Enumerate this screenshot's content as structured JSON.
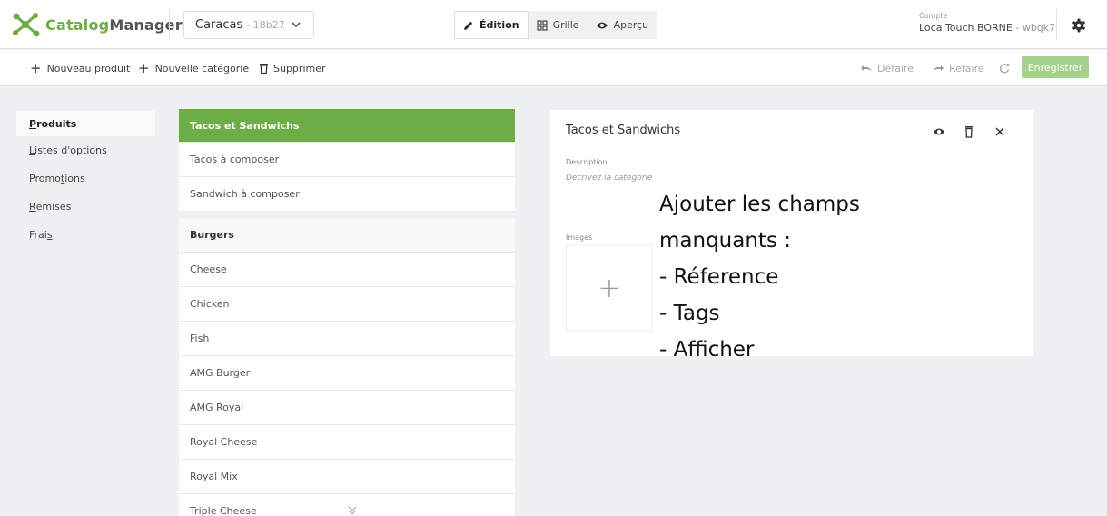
{
  "app": {
    "name_part1": "Catalog",
    "name_part2": "Manager",
    "brand_color": "#6cae45"
  },
  "site": {
    "name": "Caracas",
    "code": "- 18b27"
  },
  "modes": [
    {
      "label": "Édition",
      "icon": "pencil-icon",
      "active": true
    },
    {
      "label": "Grille",
      "icon": "grid-icon",
      "active": false
    },
    {
      "label": "Aperçu",
      "icon": "eye-icon",
      "active": false
    }
  ],
  "account": {
    "label": "Compte",
    "name": "Loca Touch BORNE",
    "code": "- wbqk7"
  },
  "toolbar": {
    "new_product": "Nouveau produit",
    "new_category": "Nouvelle catégorie",
    "delete": "Supprimer",
    "undo": "Défaire",
    "redo": "Refaire",
    "save": "Enregistrer"
  },
  "nav": {
    "items": [
      {
        "pre": "",
        "ul": "P",
        "post": "roduits"
      },
      {
        "pre": "",
        "ul": "L",
        "post": "istes d'options"
      },
      {
        "pre": "Promo",
        "ul": "t",
        "post": "ions"
      },
      {
        "pre": "",
        "ul": "R",
        "post": "emises"
      },
      {
        "pre": "Frai",
        "ul": "s",
        "post": ""
      }
    ]
  },
  "list": {
    "group1": [
      "Tacos et Sandwichs",
      "Tacos à composer",
      "Sandwich à composer"
    ],
    "group2": [
      "Burgers",
      "Cheese",
      "Chicken",
      "Fish",
      "AMG Burger",
      "AMG Royal",
      "Royal Cheese",
      "Royal Mix",
      "Triple Cheese"
    ]
  },
  "panel": {
    "title": "Tacos et Sandwichs",
    "description_label": "Description",
    "description_placeholder": "Décrivez la catégorie",
    "images_label": "Images",
    "add_image": "+",
    "note": "Ajouter les champs\nmanquants :\n- Réference\n- Tags\n- Afficher"
  }
}
